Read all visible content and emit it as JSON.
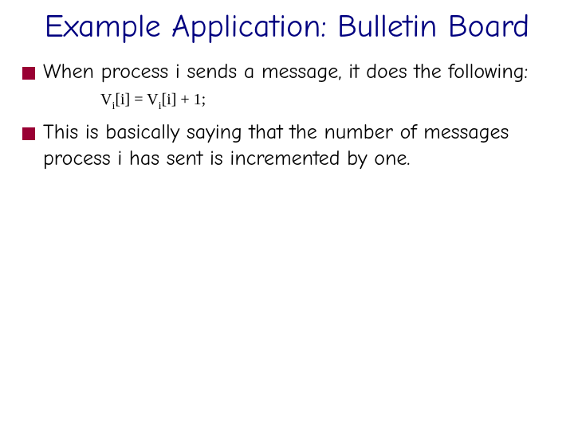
{
  "title": "Example Application: Bulletin Board",
  "bullets": [
    "When process i sends a message, it does the following:",
    "This is basically saying that the number of messages process i has sent is incremented by one."
  ],
  "formula": {
    "v": "V",
    "i": "i",
    "lb": "[i] = ",
    "v2": "V",
    "i2": "i",
    "rb": "[i] + 1;"
  }
}
